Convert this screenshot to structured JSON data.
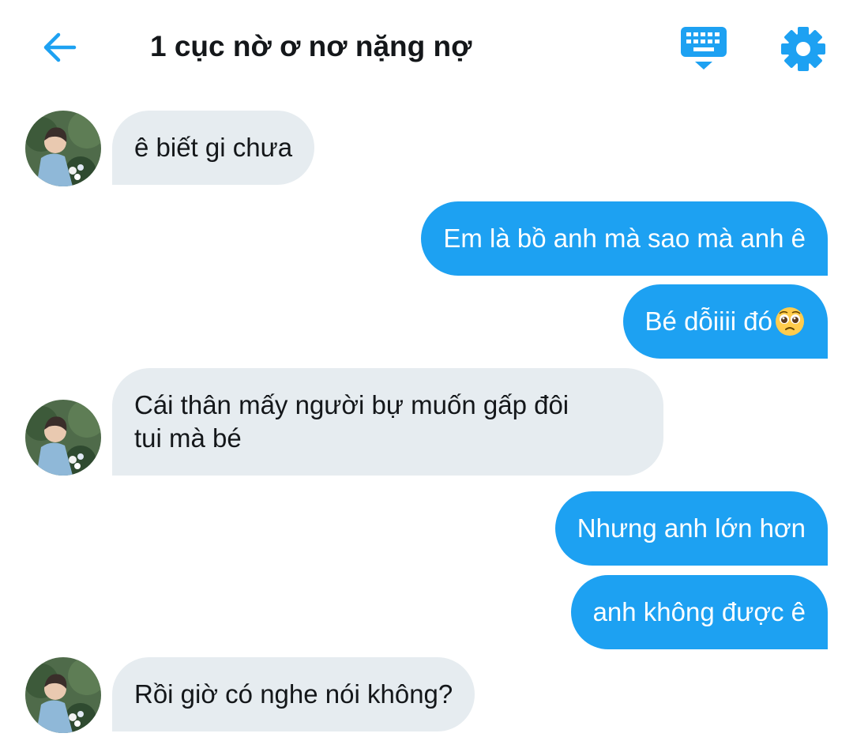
{
  "header": {
    "title": "1 cục nờ ơ nơ nặng nợ",
    "back_icon": "arrow-left-icon",
    "keyboard_icon": "keyboard-icon",
    "settings_icon": "gear-icon"
  },
  "colors": {
    "accent": "#1da1f2",
    "incoming_bubble": "#e6ecf0",
    "text": "#14171a"
  },
  "messages": [
    {
      "direction": "incoming",
      "text": "ê biết gi chưa"
    },
    {
      "direction": "outgoing",
      "text": "Em là bồ anh mà sao mà anh ê"
    },
    {
      "direction": "outgoing",
      "text": "Bé dỗiiii đó",
      "emoji": "pleading-face-emoji"
    },
    {
      "direction": "incoming",
      "text": "Cái thân mấy người bự muốn gấp đôi\ntui mà bé"
    },
    {
      "direction": "outgoing",
      "text": "Nhưng anh lớn hơn"
    },
    {
      "direction": "outgoing",
      "text": "anh không được ê"
    },
    {
      "direction": "incoming",
      "text": "Rồi giờ có nghe nói không?"
    }
  ]
}
